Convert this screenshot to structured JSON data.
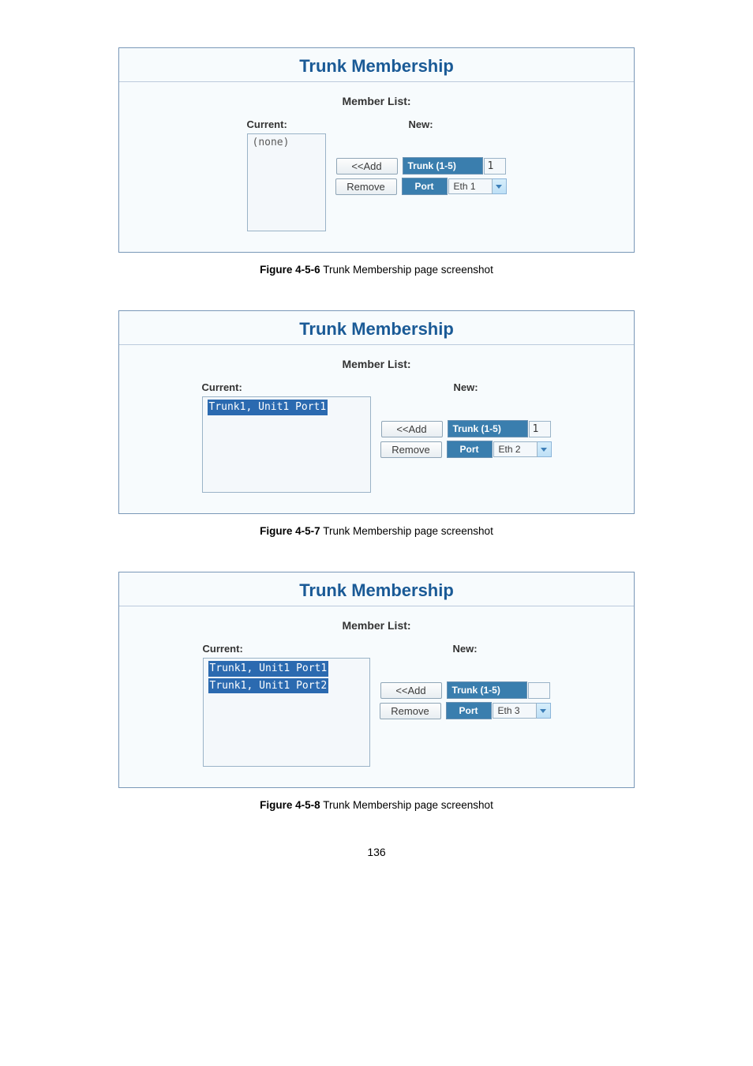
{
  "shared": {
    "panel_title": "Trunk Membership",
    "member_list": "Member List:",
    "current": "Current:",
    "new": "New:",
    "add": "<<Add",
    "remove": "Remove",
    "trunk": "Trunk (1-5)",
    "port": "Port"
  },
  "fig1": {
    "listbox_text": "(none)",
    "trunk_value": "1",
    "port_value": "Eth 1",
    "caption_b": "Figure 4-5-6",
    "caption_rest": " Trunk Membership page screenshot"
  },
  "fig2": {
    "listbox_item0": "Trunk1, Unit1 Port1",
    "trunk_value": "1",
    "port_value": "Eth 2",
    "caption_b": "Figure 4-5-7",
    "caption_rest": " Trunk Membership page screenshot"
  },
  "fig3": {
    "listbox_item0": "Trunk1, Unit1 Port1",
    "listbox_item1": "Trunk1, Unit1 Port2",
    "trunk_value": "",
    "port_value": "Eth 3",
    "caption_b": "Figure 4-5-8",
    "caption_rest": " Trunk Membership page screenshot"
  },
  "page_number": "136"
}
